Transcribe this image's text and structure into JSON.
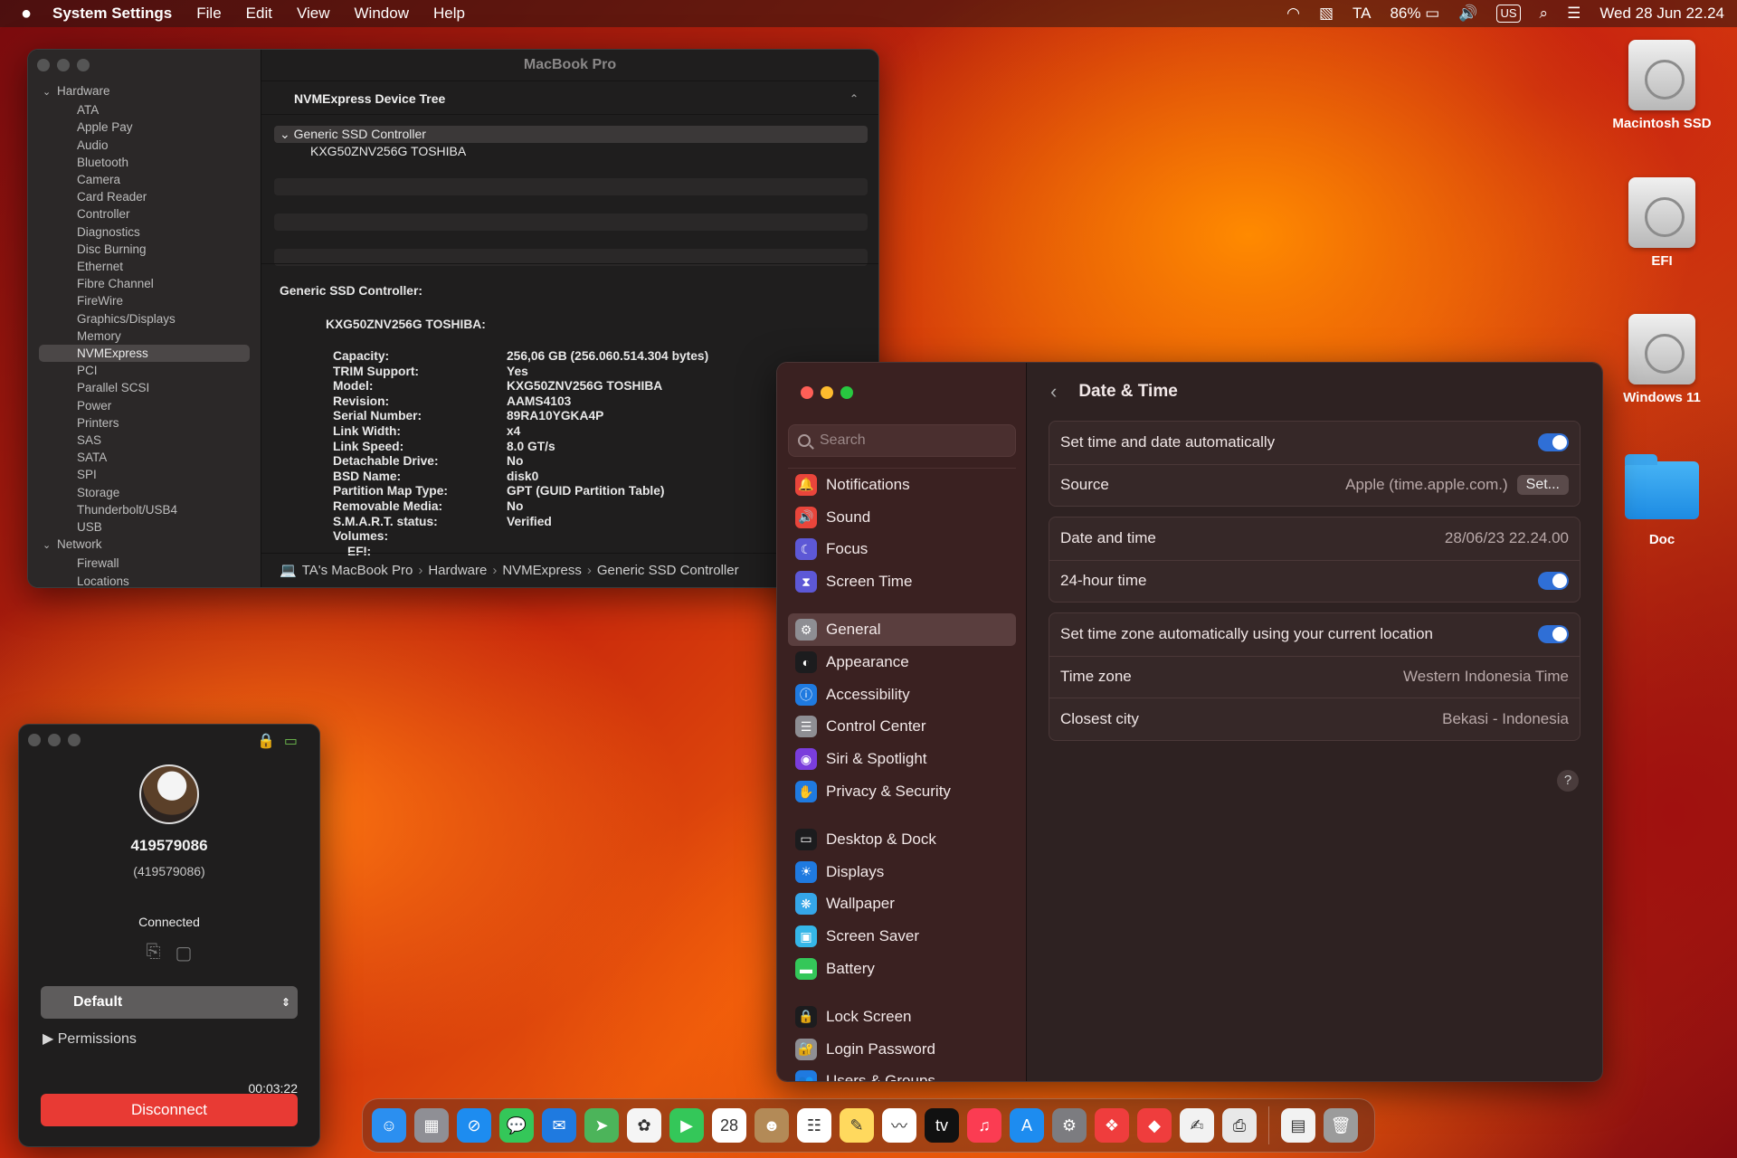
{
  "menubar": {
    "apple": "",
    "app": "System Settings",
    "items": [
      "File",
      "Edit",
      "View",
      "Window",
      "Help"
    ],
    "user": "TA",
    "battery": "86%",
    "input": "US",
    "datetime": "Wed 28 Jun  22.24"
  },
  "desktop": {
    "icons": [
      "Macintosh SSD",
      "EFI",
      "Windows 11",
      "Doc"
    ]
  },
  "sysinfo": {
    "title": "MacBook Pro",
    "sidebar": {
      "hardware_label": "Hardware",
      "hardware_items": [
        "ATA",
        "Apple Pay",
        "Audio",
        "Bluetooth",
        "Camera",
        "Card Reader",
        "Controller",
        "Diagnostics",
        "Disc Burning",
        "Ethernet",
        "Fibre Channel",
        "FireWire",
        "Graphics/Displays",
        "Memory",
        "NVMExpress",
        "PCI",
        "Parallel SCSI",
        "Power",
        "Printers",
        "SAS",
        "SATA",
        "SPI",
        "Storage",
        "Thunderbolt/USB4",
        "USB"
      ],
      "network_label": "Network",
      "network_items": [
        "Firewall",
        "Locations"
      ]
    },
    "tree_header": "NVMExpress Device Tree",
    "tree_parent": "Generic SSD Controller",
    "tree_child": "KXG50ZNV256G TOSHIBA",
    "detail_title": "Generic SSD Controller:",
    "detail_device": "KXG50ZNV256G TOSHIBA:",
    "details": [
      {
        "k": "Capacity:",
        "v": "256,06 GB (256.060.514.304 bytes)"
      },
      {
        "k": "TRIM Support:",
        "v": "Yes"
      },
      {
        "k": "Model:",
        "v": "KXG50ZNV256G TOSHIBA"
      },
      {
        "k": "Revision:",
        "v": "AAMS4103"
      },
      {
        "k": "Serial Number:",
        "v": "89RA10YGKA4P"
      },
      {
        "k": "Link Width:",
        "v": "x4"
      },
      {
        "k": "Link Speed:",
        "v": "8.0 GT/s"
      },
      {
        "k": "Detachable Drive:",
        "v": "No"
      },
      {
        "k": "BSD Name:",
        "v": "disk0"
      },
      {
        "k": "Partition Map Type:",
        "v": "GPT (GUID Partition Table)"
      },
      {
        "k": "Removable Media:",
        "v": "No"
      },
      {
        "k": "S.M.A.R.T. status:",
        "v": "Verified"
      },
      {
        "k": "Volumes:",
        "v": ""
      },
      {
        "k": "EFI:",
        "v": ""
      }
    ],
    "path": [
      "TA's MacBook Pro",
      "Hardware",
      "NVMExpress",
      "Generic SSD Controller"
    ]
  },
  "settings": {
    "search_placeholder": "Search",
    "nav_sections": [
      [
        {
          "label": "Notifications",
          "icon": "bell-icon",
          "color": "#e9453b",
          "glyph": "🔔"
        },
        {
          "label": "Sound",
          "icon": "speaker-icon",
          "color": "#e9453b",
          "glyph": "🔊"
        },
        {
          "label": "Focus",
          "icon": "moon-icon",
          "color": "#5d58d6",
          "glyph": "☾"
        },
        {
          "label": "Screen Time",
          "icon": "hourglass-icon",
          "color": "#5d58d6",
          "glyph": "⧗"
        }
      ],
      [
        {
          "label": "General",
          "icon": "gear-icon",
          "color": "#8e8e93",
          "glyph": "⚙",
          "active": true
        },
        {
          "label": "Appearance",
          "icon": "appearance-icon",
          "color": "#1c1c1e",
          "glyph": "◐"
        },
        {
          "label": "Accessibility",
          "icon": "accessibility-icon",
          "color": "#1f7ae0",
          "glyph": "ⓘ"
        },
        {
          "label": "Control Center",
          "icon": "control-center-icon",
          "color": "#8e8e93",
          "glyph": "☰"
        },
        {
          "label": "Siri & Spotlight",
          "icon": "siri-icon",
          "color": "#7a3ddc",
          "glyph": "◉"
        },
        {
          "label": "Privacy & Security",
          "icon": "hand-icon",
          "color": "#1f7ae0",
          "glyph": "✋"
        }
      ],
      [
        {
          "label": "Desktop & Dock",
          "icon": "dock-icon",
          "color": "#1c1c1e",
          "glyph": "▭"
        },
        {
          "label": "Displays",
          "icon": "display-icon",
          "color": "#1f7ae0",
          "glyph": "☀"
        },
        {
          "label": "Wallpaper",
          "icon": "wallpaper-icon",
          "color": "#35a6e8",
          "glyph": "❋"
        },
        {
          "label": "Screen Saver",
          "icon": "screensaver-icon",
          "color": "#35b6e8",
          "glyph": "▣"
        },
        {
          "label": "Battery",
          "icon": "battery-icon",
          "color": "#34c759",
          "glyph": "▬"
        }
      ],
      [
        {
          "label": "Lock Screen",
          "icon": "lock-screen-icon",
          "color": "#1c1c1e",
          "glyph": "🔒"
        },
        {
          "label": "Login Password",
          "icon": "padlock-icon",
          "color": "#8e8e93",
          "glyph": "🔐"
        },
        {
          "label": "Users & Groups",
          "icon": "users-icon",
          "color": "#1f7ae0",
          "glyph": "👥"
        }
      ]
    ],
    "page_title": "Date & Time",
    "cards": [
      [
        {
          "label": "Set time and date automatically",
          "toggle": true
        },
        {
          "label": "Source",
          "value": "Apple (time.apple.com.)",
          "button": "Set..."
        }
      ],
      [
        {
          "label": "Date and time",
          "value": "28/06/23 22.24.00"
        },
        {
          "label": "24-hour time",
          "toggle": true
        }
      ],
      [
        {
          "label": "Set time zone automatically using your current location",
          "toggle": true
        },
        {
          "label": "Time zone",
          "value": "Western Indonesia Time"
        },
        {
          "label": "Closest city",
          "value": "Bekasi - Indonesia"
        }
      ]
    ],
    "help": "?"
  },
  "remote": {
    "id": "419579086",
    "sub": "(419579086)",
    "status": "Connected",
    "profile": "Default",
    "permissions": "Permissions",
    "timer": "00:03:22",
    "disconnect": "Disconnect"
  },
  "dock": {
    "apps": [
      {
        "name": "finder-icon",
        "color": "#2b8ff0",
        "glyph": "☺"
      },
      {
        "name": "launchpad-icon",
        "color": "#8f8f95",
        "glyph": "▦"
      },
      {
        "name": "safari-icon",
        "color": "#1d8cf0",
        "glyph": "⊘"
      },
      {
        "name": "messages-icon",
        "color": "#34c759",
        "glyph": "💬"
      },
      {
        "name": "mail-icon",
        "color": "#1f7ae0",
        "glyph": "✉"
      },
      {
        "name": "maps-icon",
        "color": "#4cb45a",
        "glyph": "➤"
      },
      {
        "name": "photos-icon",
        "color": "#f5f5f5",
        "glyph": "✿"
      },
      {
        "name": "facetime-icon",
        "color": "#34c759",
        "glyph": "▶"
      },
      {
        "name": "calendar-icon",
        "color": "#ffffff",
        "glyph": "28"
      },
      {
        "name": "contacts-icon",
        "color": "#b38a57",
        "glyph": "☻"
      },
      {
        "name": "reminders-icon",
        "color": "#ffffff",
        "glyph": "☷"
      },
      {
        "name": "notes-icon",
        "color": "#ffd95e",
        "glyph": "✎"
      },
      {
        "name": "freeform-icon",
        "color": "#ffffff",
        "glyph": "〰"
      },
      {
        "name": "tv-icon",
        "color": "#111111",
        "glyph": "tv"
      },
      {
        "name": "music-icon",
        "color": "#fb3c52",
        "glyph": "♫"
      },
      {
        "name": "app-store-icon",
        "color": "#1d8cf0",
        "glyph": "A"
      },
      {
        "name": "system-settings-icon",
        "color": "#7c7c80",
        "glyph": "⚙"
      },
      {
        "name": "remote-desktop-icon",
        "color": "#ef3d3d",
        "glyph": "❖"
      },
      {
        "name": "anydesk-icon",
        "color": "#ef3d3d",
        "glyph": "◆"
      },
      {
        "name": "textedit-icon",
        "color": "#f2f2f2",
        "glyph": "✍"
      },
      {
        "name": "printer-icon",
        "color": "#e8e8e8",
        "glyph": "⎙"
      },
      {
        "name": "document-icon",
        "color": "#f2f2f2",
        "glyph": "▤"
      },
      {
        "name": "trash-icon",
        "color": "#9b9b9b",
        "glyph": "🗑"
      }
    ]
  }
}
